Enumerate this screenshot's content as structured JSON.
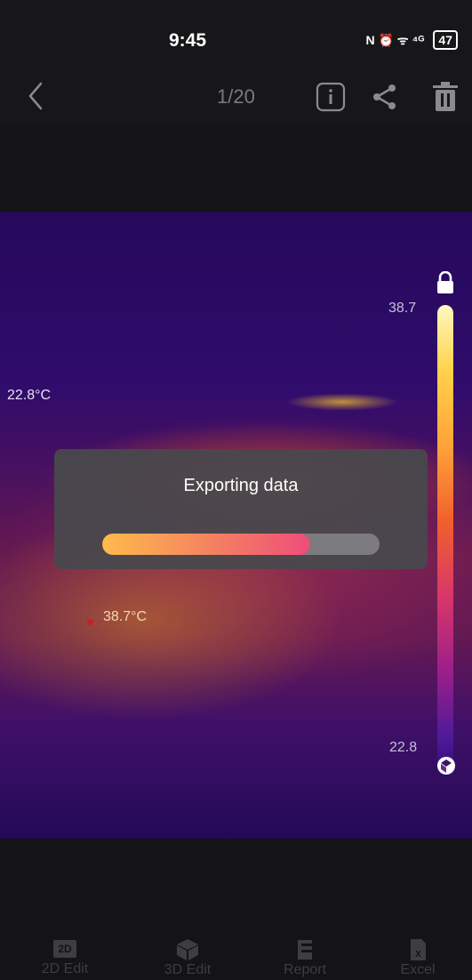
{
  "status_bar": {
    "time": "9:45",
    "indicators": "N ⏰ ᯤ ⁴ᴳ",
    "battery": "47"
  },
  "header": {
    "page_counter": "1/20",
    "icons": [
      "chevron-left-icon",
      "info-icon",
      "share-icon",
      "trash-icon"
    ]
  },
  "thermal_view": {
    "min_spot_label": "22.8°C",
    "max_spot_label": "38.7°C",
    "scale_max": "38.7",
    "scale_min": "22.8",
    "icons": [
      "lock-icon",
      "palette-icon"
    ]
  },
  "export_dialog": {
    "title": "Exporting data",
    "progress": 0.75,
    "colors": {
      "start": "#ffba4c",
      "end": "#ee4d79",
      "track": "#7b7b80"
    }
  },
  "bottom_tabs": {
    "items": [
      {
        "label": "2D Edit",
        "icon": "2d-edit-icon",
        "badge": "2D"
      },
      {
        "label": "3D Edit",
        "icon": "cube-icon"
      },
      {
        "label": "Report",
        "icon": "report-icon"
      },
      {
        "label": "Excel",
        "icon": "excel-icon",
        "badge": "X"
      }
    ]
  }
}
